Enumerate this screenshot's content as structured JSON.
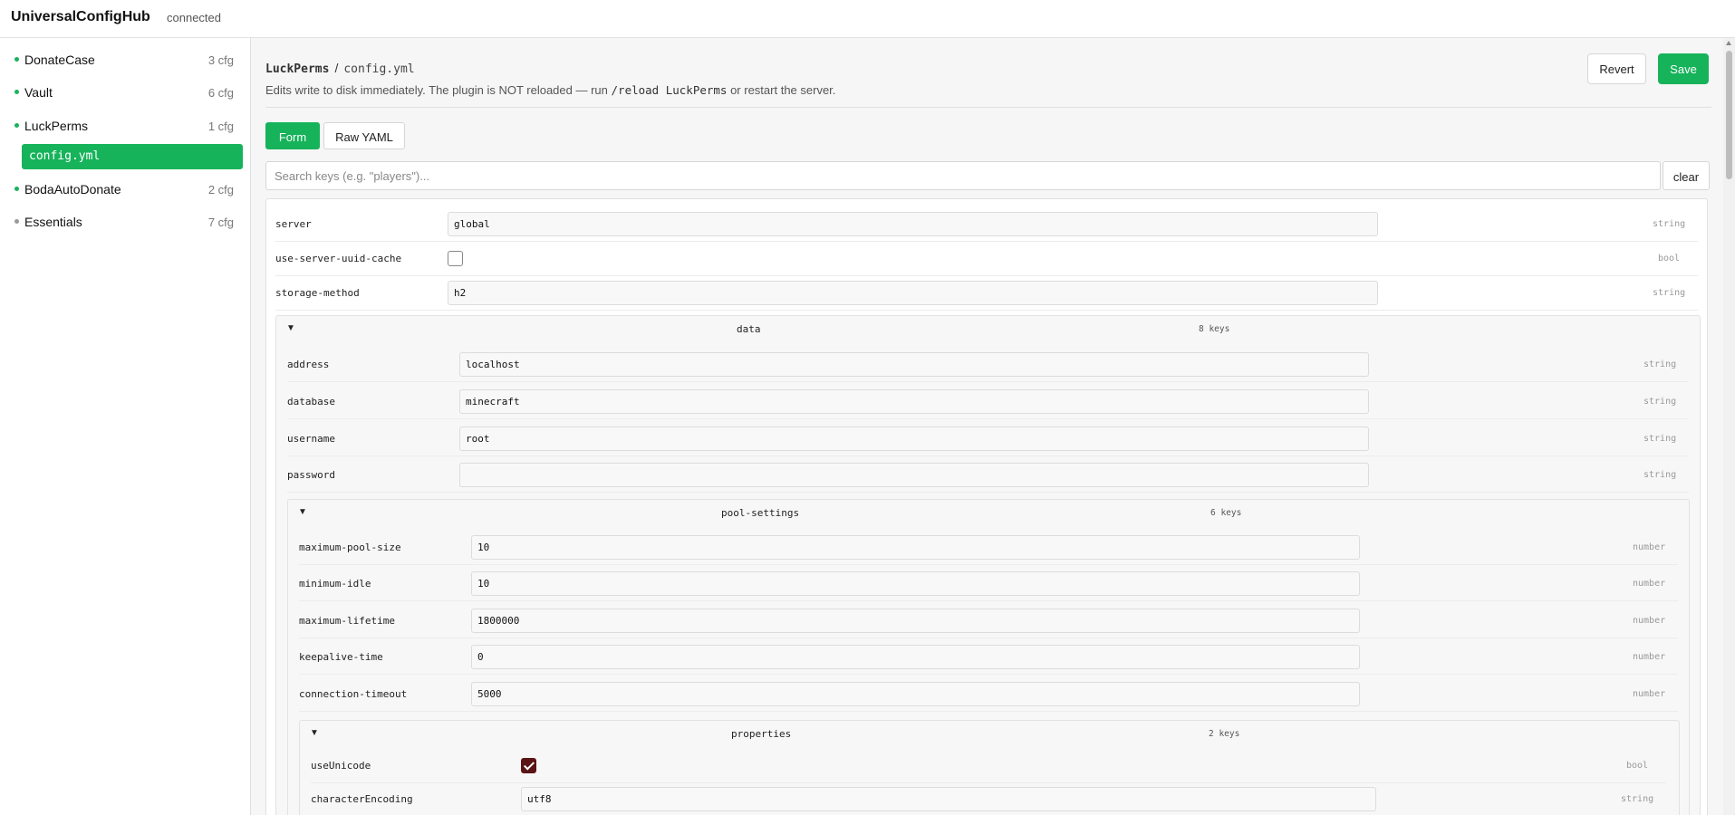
{
  "app": {
    "title": "UniversalConfigHub",
    "status": "connected"
  },
  "sidebar": {
    "items": [
      {
        "name": "DonateCase",
        "count": "3 cfg"
      },
      {
        "name": "Vault",
        "count": "6 cfg"
      },
      {
        "name": "LuckPerms",
        "count": "1 cfg"
      },
      {
        "name": "BodaAutoDonate",
        "count": "2 cfg"
      },
      {
        "name": "Essentials",
        "count": "7 cfg"
      }
    ],
    "selected_file": "config.yml"
  },
  "header": {
    "plugin": "LuckPerms",
    "separator": "/",
    "file": "config.yml",
    "desc_prefix": "Edits write to disk immediately. The plugin is NOT reloaded — run",
    "desc_command": "/reload LuckPerms",
    "desc_suffix": "or restart the server.",
    "revert_label": "Revert",
    "save_label": "Save"
  },
  "tabs": {
    "form": "Form",
    "raw": "Raw YAML"
  },
  "search": {
    "placeholder": "Search keys (e.g. \"players\")...",
    "clear_label": "clear"
  },
  "form": {
    "server": {
      "key": "server",
      "value": "global",
      "type": "string"
    },
    "use_server_uuid_cache": {
      "key": "use-server-uuid-cache",
      "checked": false,
      "type": "bool"
    },
    "storage_method": {
      "key": "storage-method",
      "value": "h2",
      "type": "string"
    },
    "data": {
      "name": "data",
      "count": "8 keys",
      "address": {
        "key": "address",
        "value": "localhost",
        "type": "string"
      },
      "database": {
        "key": "database",
        "value": "minecraft",
        "type": "string"
      },
      "username": {
        "key": "username",
        "value": "root",
        "type": "string"
      },
      "password": {
        "key": "password",
        "value": "",
        "type": "string"
      },
      "pool_settings": {
        "name": "pool-settings",
        "count": "6 keys",
        "maximum_pool_size": {
          "key": "maximum-pool-size",
          "value": "10",
          "type": "number"
        },
        "minimum_idle": {
          "key": "minimum-idle",
          "value": "10",
          "type": "number"
        },
        "maximum_lifetime": {
          "key": "maximum-lifetime",
          "value": "1800000",
          "type": "number"
        },
        "keepalive_time": {
          "key": "keepalive-time",
          "value": "0",
          "type": "number"
        },
        "connection_timeout": {
          "key": "connection-timeout",
          "value": "5000",
          "type": "number"
        },
        "properties": {
          "name": "properties",
          "count": "2 keys",
          "useUnicode": {
            "key": "useUnicode",
            "checked": true,
            "type": "bool"
          },
          "characterEncoding": {
            "key": "characterEncoding",
            "value": "utf8",
            "type": "string"
          }
        }
      }
    }
  },
  "colors": {
    "accent": "#16b35a",
    "checkbox_checked": "#5a1414"
  }
}
